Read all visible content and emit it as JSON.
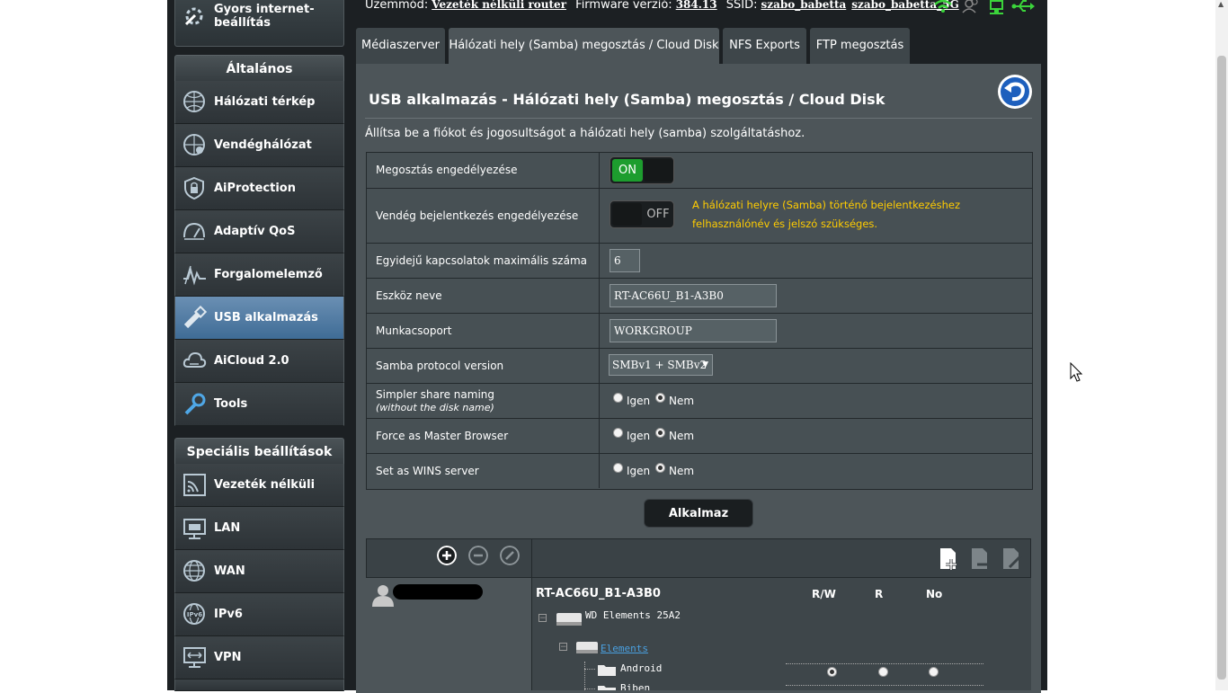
{
  "top": {
    "mode_label": "Üzemmód:",
    "mode_value": "Vezeték nélküli router",
    "firmware_label": "Firmware verzió:",
    "firmware_value": "384.13",
    "ssid_label": "SSID:",
    "ssid_1": "szabo_babetta",
    "ssid_2": "szabo_babetta_5G"
  },
  "sidebar": {
    "quick_setup": "Gyors internet-\nbeállítás",
    "quick_setup_l1": "Gyors internet-",
    "quick_setup_l2": "beállítás",
    "general_header": "Általános",
    "general_items": [
      {
        "label": "Hálózati térkép",
        "icon": "network-map-icon"
      },
      {
        "label": "Vendéghálózat",
        "icon": "guest-network-icon"
      },
      {
        "label": "AiProtection",
        "icon": "shield-lock-icon"
      },
      {
        "label": "Adaptív QoS",
        "icon": "speedometer-icon"
      },
      {
        "label": "Forgalomelemző",
        "icon": "traffic-analyzer-icon"
      },
      {
        "label": "USB alkalmazás",
        "icon": "usb-icon"
      },
      {
        "label": "AiCloud 2.0",
        "icon": "cloud-icon"
      },
      {
        "label": "Tools",
        "icon": "wrench-icon"
      }
    ],
    "advanced_header": "Speciális beállítások",
    "advanced_items": [
      {
        "label": "Vezeték nélküli",
        "icon": "wireless-icon"
      },
      {
        "label": "LAN",
        "icon": "lan-icon"
      },
      {
        "label": "WAN",
        "icon": "globe-icon"
      },
      {
        "label": "IPv6",
        "icon": "ipv6-globe-icon"
      },
      {
        "label": "VPN",
        "icon": "vpn-icon"
      }
    ]
  },
  "tabs": [
    {
      "label": "Médiaszerver"
    },
    {
      "label": "Hálózati hely (Samba) megosztás / Cloud Disk"
    },
    {
      "label": "NFS Exports"
    },
    {
      "label": "FTP megosztás"
    }
  ],
  "main": {
    "title": "USB alkalmazás - Hálózati hely (Samba) megosztás / Cloud Disk",
    "description": "Állítsa be a fiókot és jogosultságot a hálózati hely (samba) szolgáltatáshoz.",
    "rows": {
      "enable_share": {
        "label": "Megosztás engedélyezése",
        "value": "ON"
      },
      "guest_login": {
        "label": "Vendég bejelentkezés engedélyezése",
        "value": "OFF",
        "warning": "A hálózati helyre (Samba) történő bejelentkezéshez felhasználónév és jelszó szükséges."
      },
      "max_connections": {
        "label": "Egyidejű kapcsolatok maximális száma",
        "value": "6"
      },
      "device_name": {
        "label": "Eszköz neve",
        "value": "RT-AC66U_B1-A3B0"
      },
      "workgroup": {
        "label": "Munkacsoport",
        "value": "WORKGROUP"
      },
      "samba_version": {
        "label": "Samba protocol version",
        "value": "SMBv1 + SMBv2"
      },
      "simpler_naming": {
        "label": "Simpler share naming",
        "sublabel": "(without the disk name)",
        "value": "Nem"
      },
      "master_browser": {
        "label": "Force as Master Browser",
        "value": "Nem"
      },
      "wins_server": {
        "label": "Set as WINS server",
        "value": "Nem"
      }
    },
    "radio_yes": "Igen",
    "radio_no": "Nem",
    "apply_label": "Alkalmaz"
  },
  "permissions": {
    "device": "RT-AC66U_B1-A3B0",
    "columns": [
      "R/W",
      "R",
      "No"
    ],
    "disk": "WD Elements 25A2",
    "volume": "Elements",
    "folders": [
      "Android",
      "Biben"
    ],
    "android_permission": "R/W"
  },
  "colors": {
    "toggle_on": "#1d9d2e",
    "warning": "#ffcc00",
    "active_nav": "#4f7aa3"
  }
}
